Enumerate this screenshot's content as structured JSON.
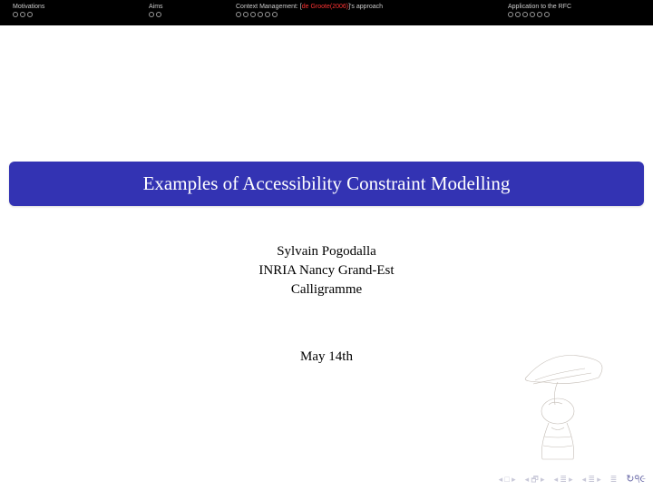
{
  "nav": {
    "sections": [
      {
        "label_pre": "Motivations",
        "label_cite": "",
        "label_post": "",
        "dots": 3
      },
      {
        "label_pre": "Aims",
        "label_cite": "",
        "label_post": "",
        "dots": 2
      },
      {
        "label_pre": "Context Management: [",
        "label_cite": "de Groote(2006)",
        "label_post": "]'s approach",
        "dots": 6
      },
      {
        "label_pre": "Application to the RFC",
        "label_cite": "",
        "label_post": "",
        "dots": 6
      }
    ]
  },
  "title": "Examples of Accessibility Constraint Modelling",
  "author": {
    "name": "Sylvain Pogodalla",
    "affiliation": "INRIA Nancy Grand-Est",
    "group": "Calligramme"
  },
  "date": "May 14th",
  "footer": {
    "first": "◂ □ ▸",
    "frame": "◂ 🗗 ▸",
    "section_back": "◂ ≣ ▸",
    "section_fwd": "◂ ≣ ▸",
    "mode": "≣",
    "refresh": "↻੧૯"
  }
}
